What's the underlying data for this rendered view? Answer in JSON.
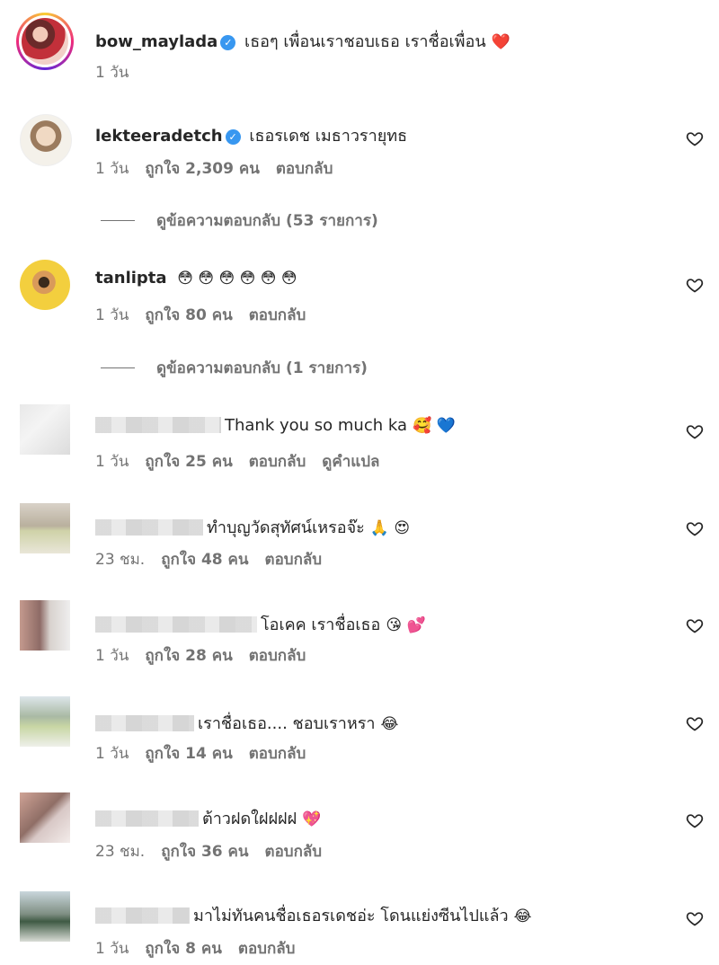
{
  "comments": [
    {
      "username": "bow_maylada",
      "verified": true,
      "text": "เธอๆ เพื่อนเราชอบเธอ เราชื่อเพื่อน",
      "emoji": "❤️",
      "time": "1 วัน",
      "likes": "",
      "reply": ""
    },
    {
      "username": "lekteeradetch",
      "verified": true,
      "text": "เธอรเดช เมธาวรายุทธ",
      "emoji": "",
      "time": "1 วัน",
      "likes": "ถูกใจ 2,309 คน",
      "reply": "ตอบกลับ",
      "view_replies": "ดูข้อความตอบกลับ (53 รายการ)"
    },
    {
      "username": "tanlipta",
      "verified": false,
      "text": "",
      "emoji": "😳 😳 😳 😳 😳 😳",
      "time": "1 วัน",
      "likes": "ถูกใจ 80 คน",
      "reply": "ตอบกลับ",
      "view_replies": "ดูข้อความตอบกลับ (1 รายการ)"
    },
    {
      "username": "",
      "verified": false,
      "text": "Thank you so much ka",
      "emoji": "🥰 💙",
      "time": "1 วัน",
      "likes": "ถูกใจ 25 คน",
      "reply": "ตอบกลับ",
      "translate": "ดูคำแปล"
    },
    {
      "username": "",
      "verified": false,
      "text": "ทำบุญวัดสุทัศน์เหรอจ๊ะ",
      "emoji": "🙏 😍",
      "time": "23 ชม.",
      "likes": "ถูกใจ 48 คน",
      "reply": "ตอบกลับ"
    },
    {
      "username": "",
      "verified": false,
      "text": "โอเคค เราชื่อเธอ",
      "emoji": "😘 💕",
      "time": "1 วัน",
      "likes": "ถูกใจ 28 คน",
      "reply": "ตอบกลับ"
    },
    {
      "username": "",
      "verified": false,
      "text": "เราชื่อเธอ.... ชอบเราหรา",
      "emoji": "😂",
      "time": "1 วัน",
      "likes": "ถูกใจ 14 คน",
      "reply": "ตอบกลับ"
    },
    {
      "username": "",
      "verified": false,
      "text": "ต้าวฝดใฝฝฝฝ",
      "emoji": "💖",
      "time": "23 ชม.",
      "likes": "ถูกใจ 36 คน",
      "reply": "ตอบกลับ"
    },
    {
      "username": "",
      "verified": false,
      "text": "มาไม่ทันคนชื่อเธอรเดชอ่ะ โดนแย่งซีนไปแล้ว",
      "emoji": "😂",
      "time": "1 วัน",
      "likes": "ถูกใจ 8 คน",
      "reply": "ตอบกลับ"
    }
  ],
  "colors": {
    "text": "#262626",
    "muted": "#737373",
    "verified": "#3897f0"
  }
}
